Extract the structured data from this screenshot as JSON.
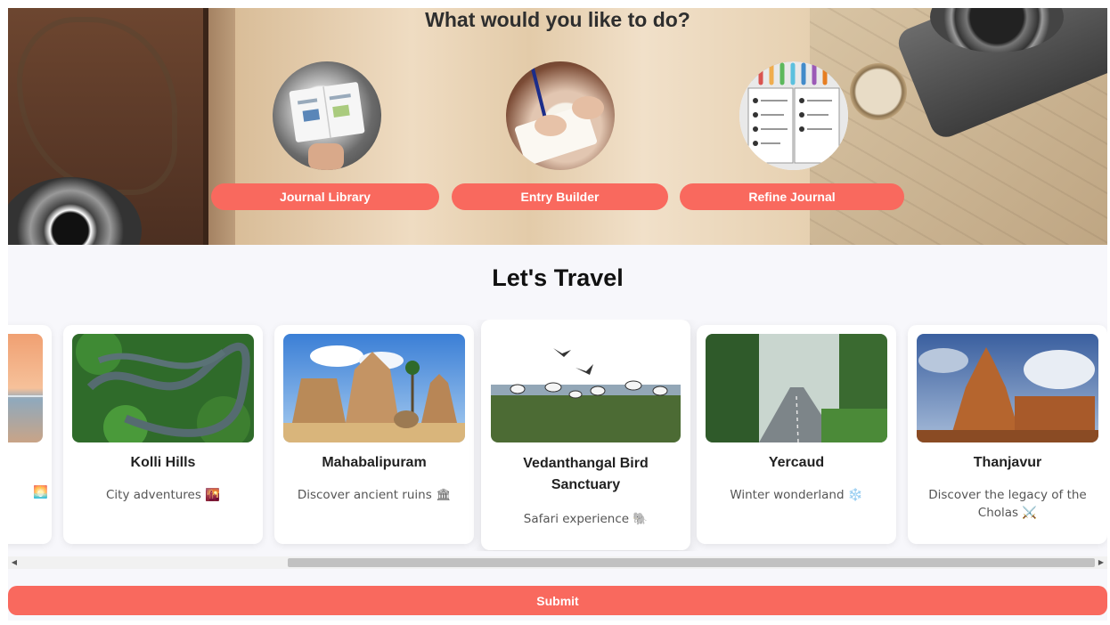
{
  "hero": {
    "title": "What would you like to do?",
    "options": [
      {
        "label": "Journal Library"
      },
      {
        "label": "Entry Builder"
      },
      {
        "label": "Refine Journal"
      }
    ]
  },
  "travel": {
    "title": "Let's Travel",
    "cards": [
      {
        "name": "",
        "description": "",
        "emoji": "🌅"
      },
      {
        "name": "Kolli Hills",
        "description": "City adventures 🌇"
      },
      {
        "name": "Mahabalipuram",
        "description": "Discover ancient ruins 🏛"
      },
      {
        "name": "Vedanthangal Bird Sanctuary",
        "description": "Safari experience 🐘"
      },
      {
        "name": "Yercaud",
        "description": "Winter wonderland ❄️"
      },
      {
        "name": "Thanjavur",
        "description": "Discover the legacy of the Cholas ⚔️"
      }
    ]
  },
  "scroll": {
    "position": 0.35
  },
  "submit": {
    "label": "Submit"
  },
  "colors": {
    "accent": "#f9695e",
    "background": "#f7f7fb",
    "card": "#ffffff"
  }
}
